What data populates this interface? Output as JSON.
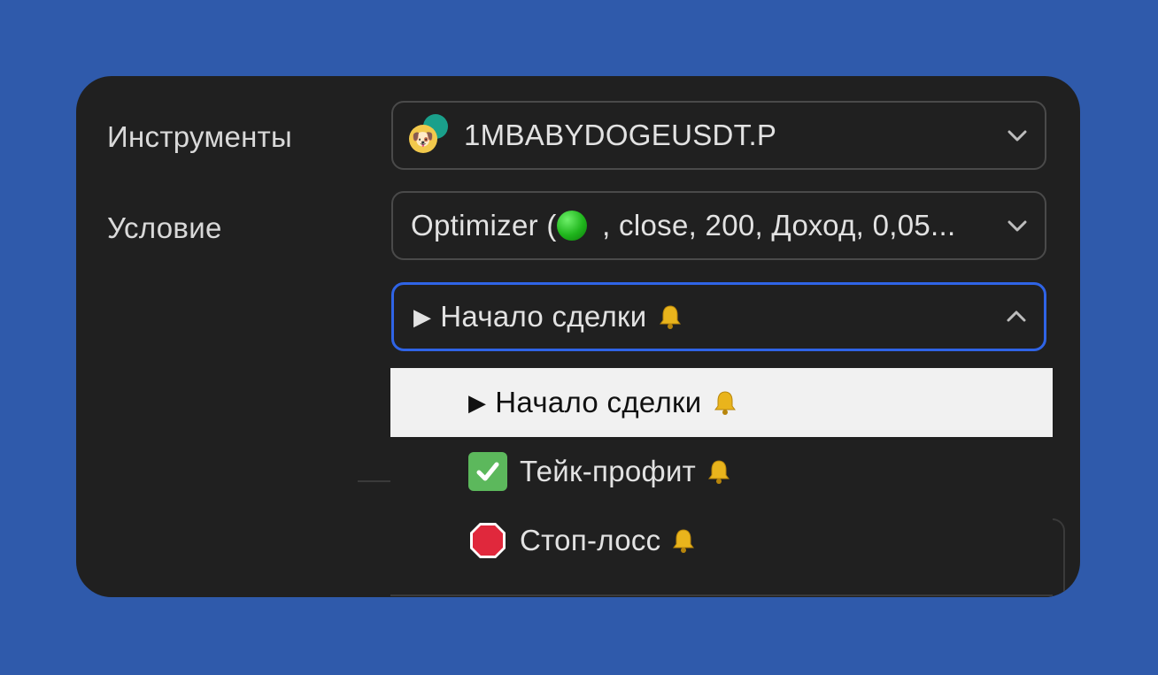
{
  "form": {
    "instrument_label": "Инструменты",
    "instrument_value": "1MBABYDOGEUSDT.P",
    "condition_label": "Условие",
    "condition_prefix": "Optimizer (",
    "condition_suffix": " , close, 200, Доход, 0,05...",
    "trigger_arrow": "▶",
    "trigger_value": "Начало сделки"
  },
  "dropdown": {
    "items": [
      {
        "label": "Начало сделки",
        "icon": "play-icon",
        "arrow": "▶",
        "selected": true
      },
      {
        "label": "Тейк-профит",
        "icon": "check-mark-icon",
        "selected": false
      },
      {
        "label": "Стоп-лосс",
        "icon": "stop-sign-icon",
        "selected": false
      }
    ]
  },
  "colors": {
    "background": "#2f5aab",
    "panel": "#202020",
    "focus_border": "#2f64e6",
    "selected_item": "#f1f1f1"
  }
}
